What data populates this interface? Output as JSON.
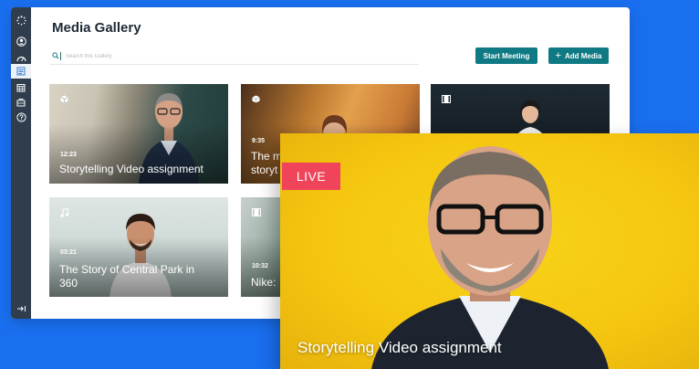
{
  "app": {
    "title": "Media Gallery",
    "search_placeholder": "Search this Gallery",
    "start_meeting_label": "Start Meeting",
    "add_media_label": "Add Media"
  },
  "sidebar": {
    "items": [
      {
        "icon": "loader-icon"
      },
      {
        "icon": "user-icon"
      },
      {
        "icon": "dashboard-icon"
      },
      {
        "icon": "media-icon",
        "active": true
      },
      {
        "icon": "calendar-icon"
      },
      {
        "icon": "library-icon"
      },
      {
        "icon": "help-icon"
      }
    ],
    "collapse_icon": "collapse-icon"
  },
  "cards": [
    {
      "type_icon": "cube-icon",
      "duration": "12:23",
      "title": "Storytelling Video assignment"
    },
    {
      "type_icon": "cube-icon",
      "duration": "9:35",
      "title": "The m\nstoryt"
    },
    {
      "type_icon": "film-icon",
      "duration": "",
      "title": ""
    },
    {
      "type_icon": "music-icon",
      "duration": "03:21",
      "title": "The Story of Central Park in\n360"
    },
    {
      "type_icon": "film-icon",
      "duration": "10:32",
      "title": "Nike:"
    }
  ],
  "live": {
    "badge": "LIVE",
    "title": "Storytelling Video assignment"
  },
  "colors": {
    "background": "#1a6ff0",
    "sidebar": "#2f3d4d",
    "button": "#0f7a84",
    "live_badge": "#f0445a",
    "live_bg": "#f5c710"
  }
}
